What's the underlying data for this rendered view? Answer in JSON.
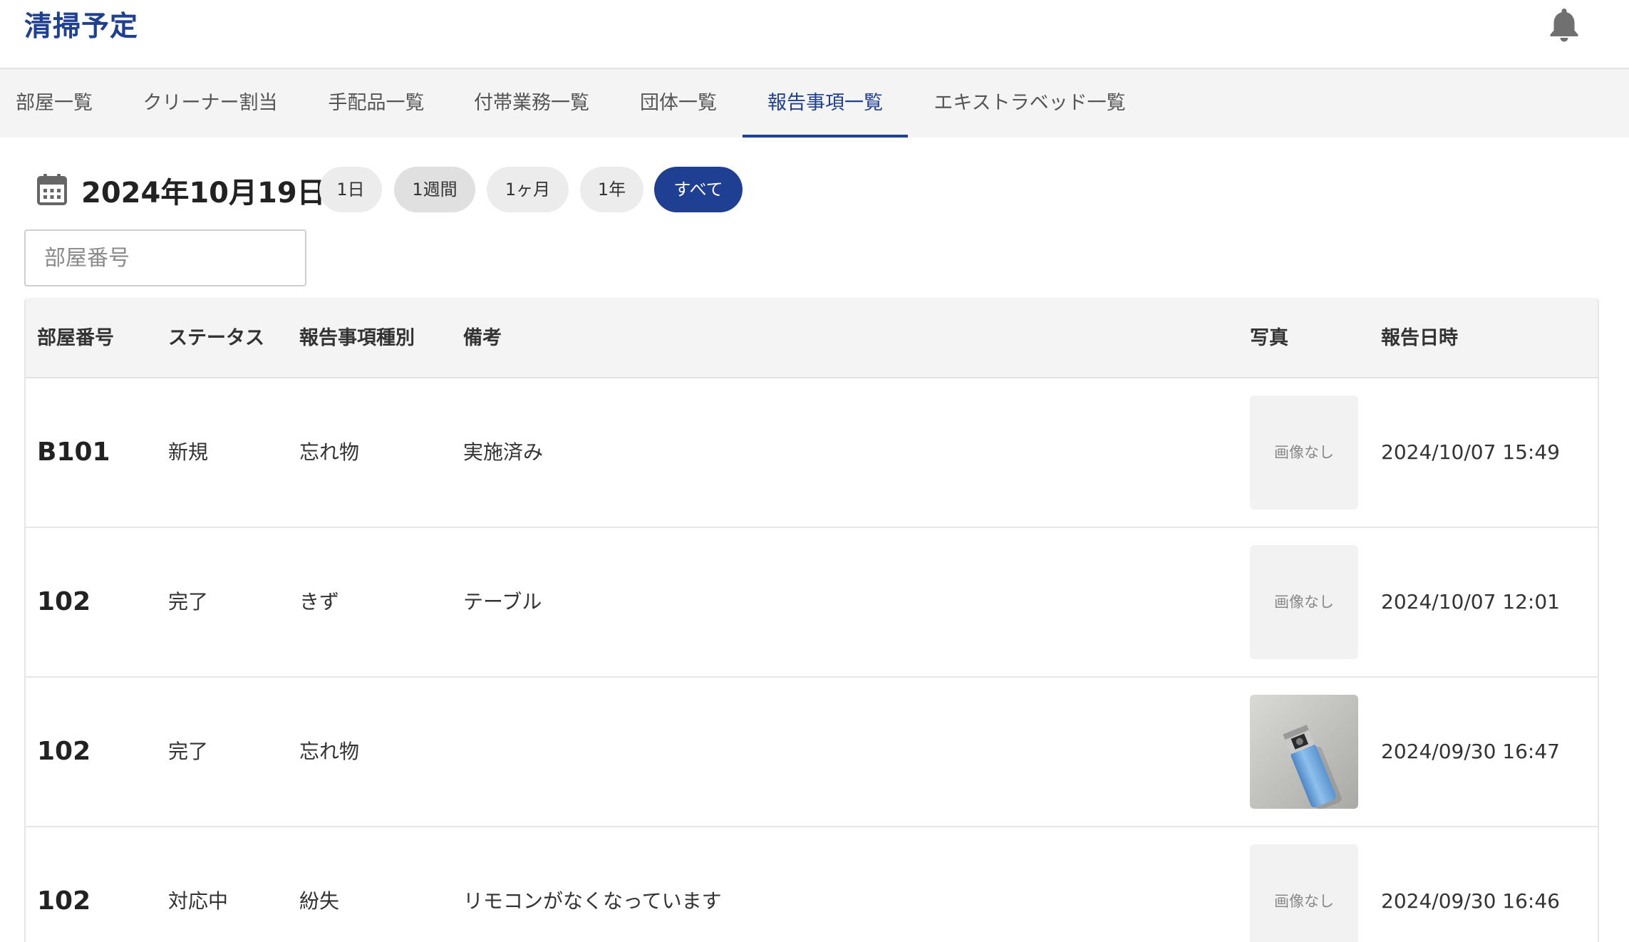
{
  "header": {
    "title": "清掃予定",
    "bell_icon": "bell-icon"
  },
  "tabs": [
    {
      "label": "部屋一覧",
      "active": false
    },
    {
      "label": "クリーナー割当",
      "active": false
    },
    {
      "label": "手配品一覧",
      "active": false
    },
    {
      "label": "付帯業務一覧",
      "active": false
    },
    {
      "label": "団体一覧",
      "active": false
    },
    {
      "label": "報告事項一覧",
      "active": true
    },
    {
      "label": "エキストラベッド一覧",
      "active": false
    }
  ],
  "filter": {
    "calendar_icon": "calendar-icon",
    "date": "2024年10月19日",
    "ranges": [
      {
        "label": "1日",
        "state": "normal"
      },
      {
        "label": "1週間",
        "state": "hover"
      },
      {
        "label": "1ヶ月",
        "state": "normal"
      },
      {
        "label": "1年",
        "state": "normal"
      },
      {
        "label": "すべて",
        "state": "active"
      }
    ],
    "search_placeholder": "部屋番号"
  },
  "table": {
    "headers": [
      "部屋番号",
      "ステータス",
      "報告事項種別",
      "備考",
      "写真",
      "報告日時"
    ],
    "no_image_label": "画像なし",
    "rows": [
      {
        "room": "B101",
        "status": "新規",
        "type": "忘れ物",
        "note": "実施済み",
        "has_photo": false,
        "datetime": "2024/10/07 15:49"
      },
      {
        "room": "102",
        "status": "完了",
        "type": "きず",
        "note": "テーブル",
        "has_photo": false,
        "datetime": "2024/10/07 12:01"
      },
      {
        "room": "102",
        "status": "完了",
        "type": "忘れ物",
        "note": "",
        "has_photo": true,
        "photo_subject": "lighter-photo",
        "datetime": "2024/09/30 16:47"
      },
      {
        "room": "102",
        "status": "対応中",
        "type": "紛失",
        "note": "リモコンがなくなっています",
        "has_photo": false,
        "datetime": "2024/09/30 16:46"
      }
    ]
  },
  "colors": {
    "accent": "#1f3f93",
    "tab_bg": "#f4f4f4",
    "header_bg": "#f4f4f4"
  }
}
